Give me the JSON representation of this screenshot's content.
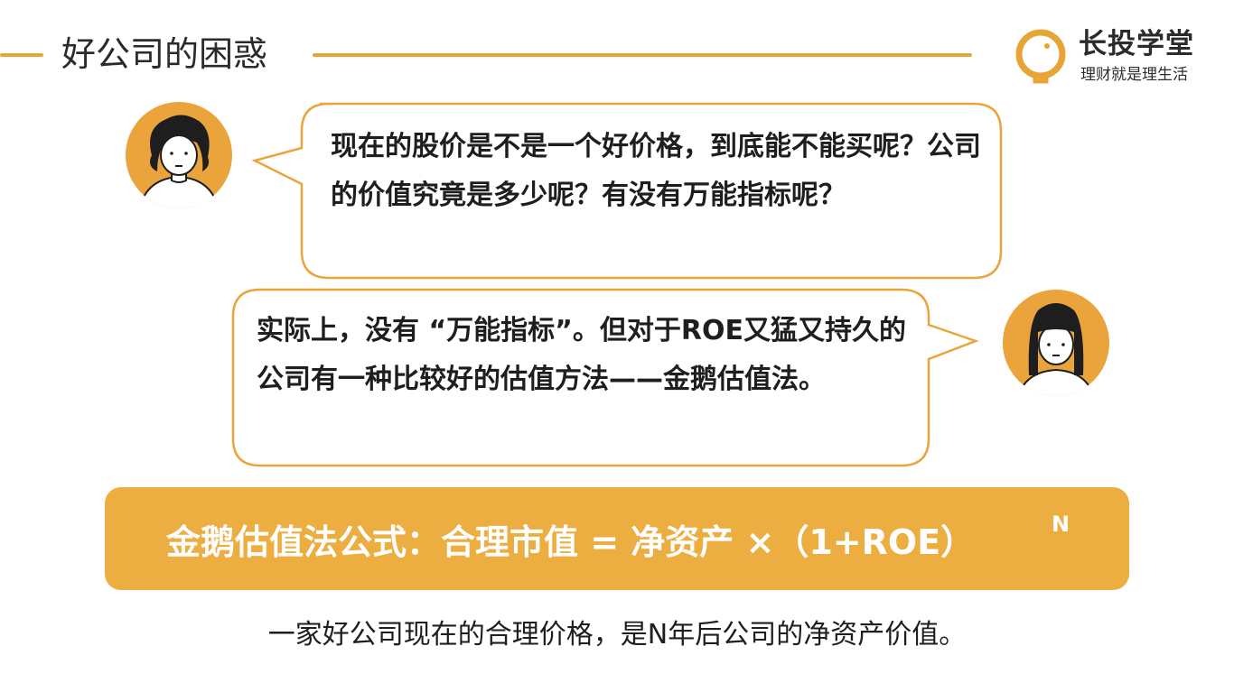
{
  "header": {
    "title": "好公司的困惑"
  },
  "logo": {
    "name": "长投学堂",
    "slogan": "理财就是理生活",
    "icon": "lightbulb-icon",
    "accent": "#E9A436"
  },
  "dialog": {
    "question": "现在的股价是不是一个好价格，到底能不能买呢？公司的价值究竟是多少呢？有没有万能指标呢？",
    "answer": "实际上，没有 “万能指标”。但对于ROE又猛又持久的公司有一种比较好的估值方法——金鹅估值法。"
  },
  "formula": {
    "text": "金鹅估值法公式：合理市值 = 净资产 ×（1+ROE）",
    "exponent": "N",
    "background": "#EDAE41"
  },
  "caption": "一家好公司现在的合理价格，是N年后公司的净资产价值。"
}
